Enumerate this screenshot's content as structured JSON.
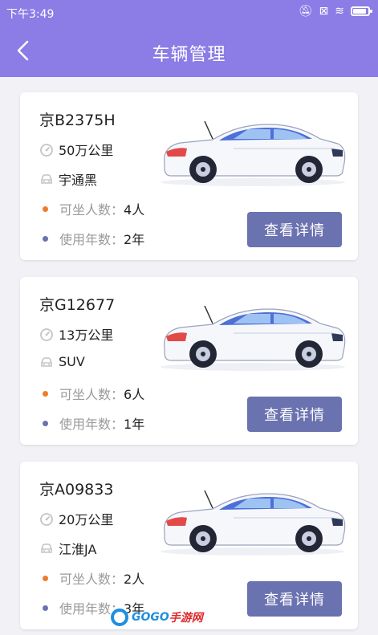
{
  "status_bar": {
    "time": "下午3:49"
  },
  "header": {
    "title": "车辆管理"
  },
  "vehicles": [
    {
      "plate": "京B2375H",
      "mileage": "50万公里",
      "model": "宇通黑",
      "seats_label": "可坐人数：",
      "seats": "4人",
      "years_label": "使用年数：",
      "years": "2年",
      "button": "查看详情"
    },
    {
      "plate": "京G12677",
      "mileage": "13万公里",
      "model": "SUV",
      "seats_label": "可坐人数：",
      "seats": "6人",
      "years_label": "使用年数：",
      "years": "1年",
      "button": "查看详情"
    },
    {
      "plate": "京A09833",
      "mileage": "20万公里",
      "model": "江淮JA",
      "seats_label": "可坐人数：",
      "seats": "2人",
      "years_label": "使用年数：",
      "years": "3年",
      "button": "查看详情"
    }
  ],
  "watermark": {
    "brand_a": "GOGO",
    "brand_b": "手游网"
  },
  "colors": {
    "header": "#8b7ce6",
    "button": "#6a72b0",
    "seats_dot": "#f07b2a",
    "years_dot": "#6a72b0"
  }
}
